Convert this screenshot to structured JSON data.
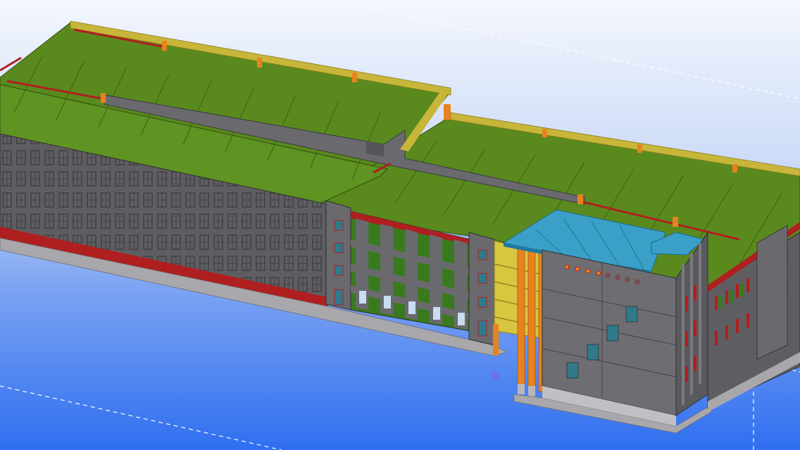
{
  "viewport": {
    "background_top": "#f4f7fd",
    "background_bottom": "#2f6ff0",
    "view": "3d-model"
  },
  "model": {
    "roof_color": "#5a8a1e",
    "wall_color": "#5e5e62",
    "parapet_color": "#c8b63a",
    "band_color": "#b01f1f",
    "canopy_color": "#3aa0c8",
    "column_color": "#e8821e",
    "plinth_color": "#a8a8ac",
    "grid_line_color": "#ffffff"
  }
}
